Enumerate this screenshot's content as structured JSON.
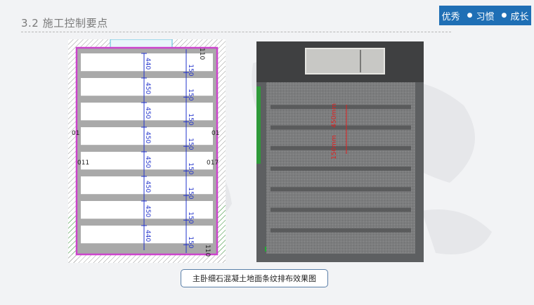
{
  "header": {
    "title": "3.2  施工控制要点",
    "slogan": [
      "优秀",
      "习惯",
      "成长"
    ]
  },
  "plan_drawing": {
    "top_edge_label": "110",
    "bottom_edge_label": "110",
    "side_label_left": "011",
    "side_label_right": "017",
    "side_mark_left": "01",
    "side_mark_right": "01",
    "slab_widths": [
      "440",
      "450",
      "450",
      "450",
      "450",
      "450",
      "450",
      "440"
    ],
    "strip_widths": [
      "150",
      "150",
      "150",
      "150",
      "150",
      "150",
      "150",
      "150"
    ]
  },
  "render_view": {
    "annotation_slab": "450mm",
    "annotation_strip": "150mm"
  },
  "caption": "主卧细石混凝土地面条纹排布效果图",
  "colors": {
    "slogan_bg": "#1f6fb5",
    "wall_outline": "#cc44cc",
    "dimension_line": "#2233cc",
    "render_annotation": "#e02020",
    "caption_border": "#5a7fa8"
  }
}
